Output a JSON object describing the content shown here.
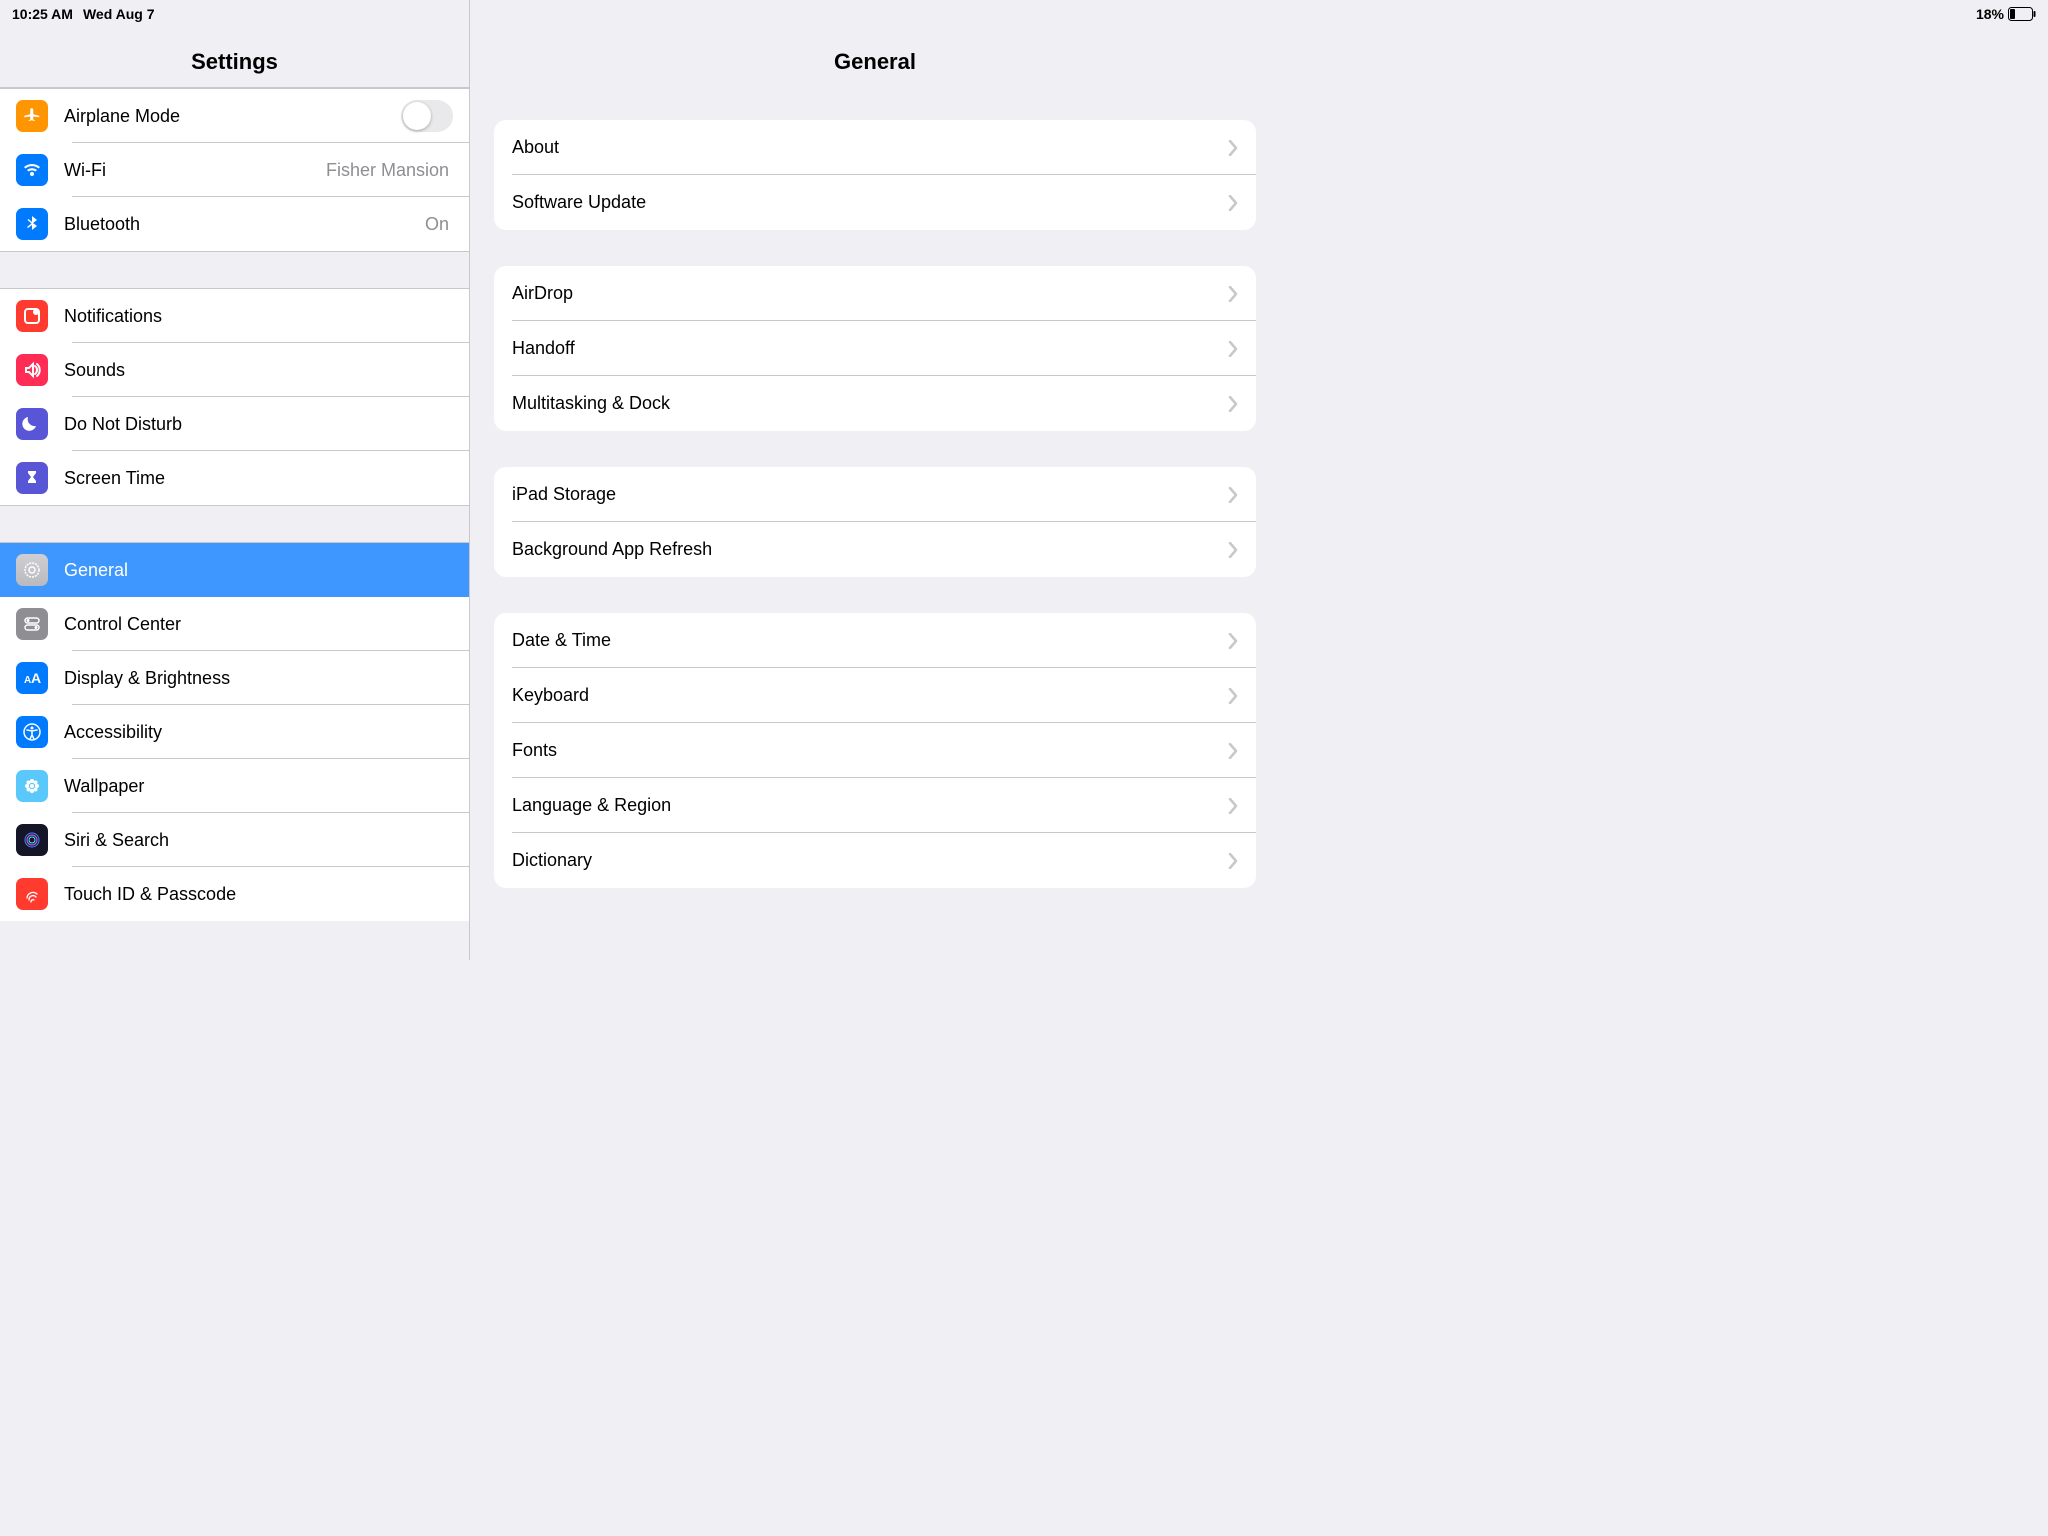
{
  "status": {
    "time": "10:25 AM",
    "date": "Wed Aug 7",
    "battery": "18%"
  },
  "sidebar": {
    "title": "Settings",
    "groups": [
      [
        {
          "id": "airplane",
          "label": "Airplane Mode",
          "toggle": false,
          "icon": "airplane-icon",
          "color": "ic-orange"
        },
        {
          "id": "wifi",
          "label": "Wi-Fi",
          "value": "Fisher Mansion",
          "icon": "wifi-icon",
          "color": "ic-blue"
        },
        {
          "id": "bluetooth",
          "label": "Bluetooth",
          "value": "On",
          "icon": "bluetooth-icon",
          "color": "ic-blue"
        }
      ],
      [
        {
          "id": "notifications",
          "label": "Notifications",
          "icon": "notifications-icon",
          "color": "ic-red"
        },
        {
          "id": "sounds",
          "label": "Sounds",
          "icon": "sounds-icon",
          "color": "ic-pink"
        },
        {
          "id": "dnd",
          "label": "Do Not Disturb",
          "icon": "moon-icon",
          "color": "ic-purple"
        },
        {
          "id": "screentime",
          "label": "Screen Time",
          "icon": "hourglass-icon",
          "color": "ic-purple"
        }
      ],
      [
        {
          "id": "general",
          "label": "General",
          "icon": "gear-icon",
          "color": "ic-white",
          "selected": true
        },
        {
          "id": "control",
          "label": "Control Center",
          "icon": "switches-icon",
          "color": "ic-gray"
        },
        {
          "id": "display",
          "label": "Display & Brightness",
          "icon": "text-size-icon",
          "color": "ic-blue"
        },
        {
          "id": "accessibility",
          "label": "Accessibility",
          "icon": "accessibility-icon",
          "color": "ic-blue"
        },
        {
          "id": "wallpaper",
          "label": "Wallpaper",
          "icon": "flower-icon",
          "color": "ic-cyan"
        },
        {
          "id": "siri",
          "label": "Siri & Search",
          "icon": "siri-icon",
          "color": "ic-dark"
        },
        {
          "id": "touchid",
          "label": "Touch ID & Passcode",
          "icon": "fingerprint-icon",
          "color": "ic-red"
        }
      ]
    ]
  },
  "detail": {
    "title": "General",
    "groups": [
      [
        "About",
        "Software Update"
      ],
      [
        "AirDrop",
        "Handoff",
        "Multitasking & Dock"
      ],
      [
        "iPad Storage",
        "Background App Refresh"
      ],
      [
        "Date & Time",
        "Keyboard",
        "Fonts",
        "Language & Region",
        "Dictionary"
      ]
    ]
  }
}
